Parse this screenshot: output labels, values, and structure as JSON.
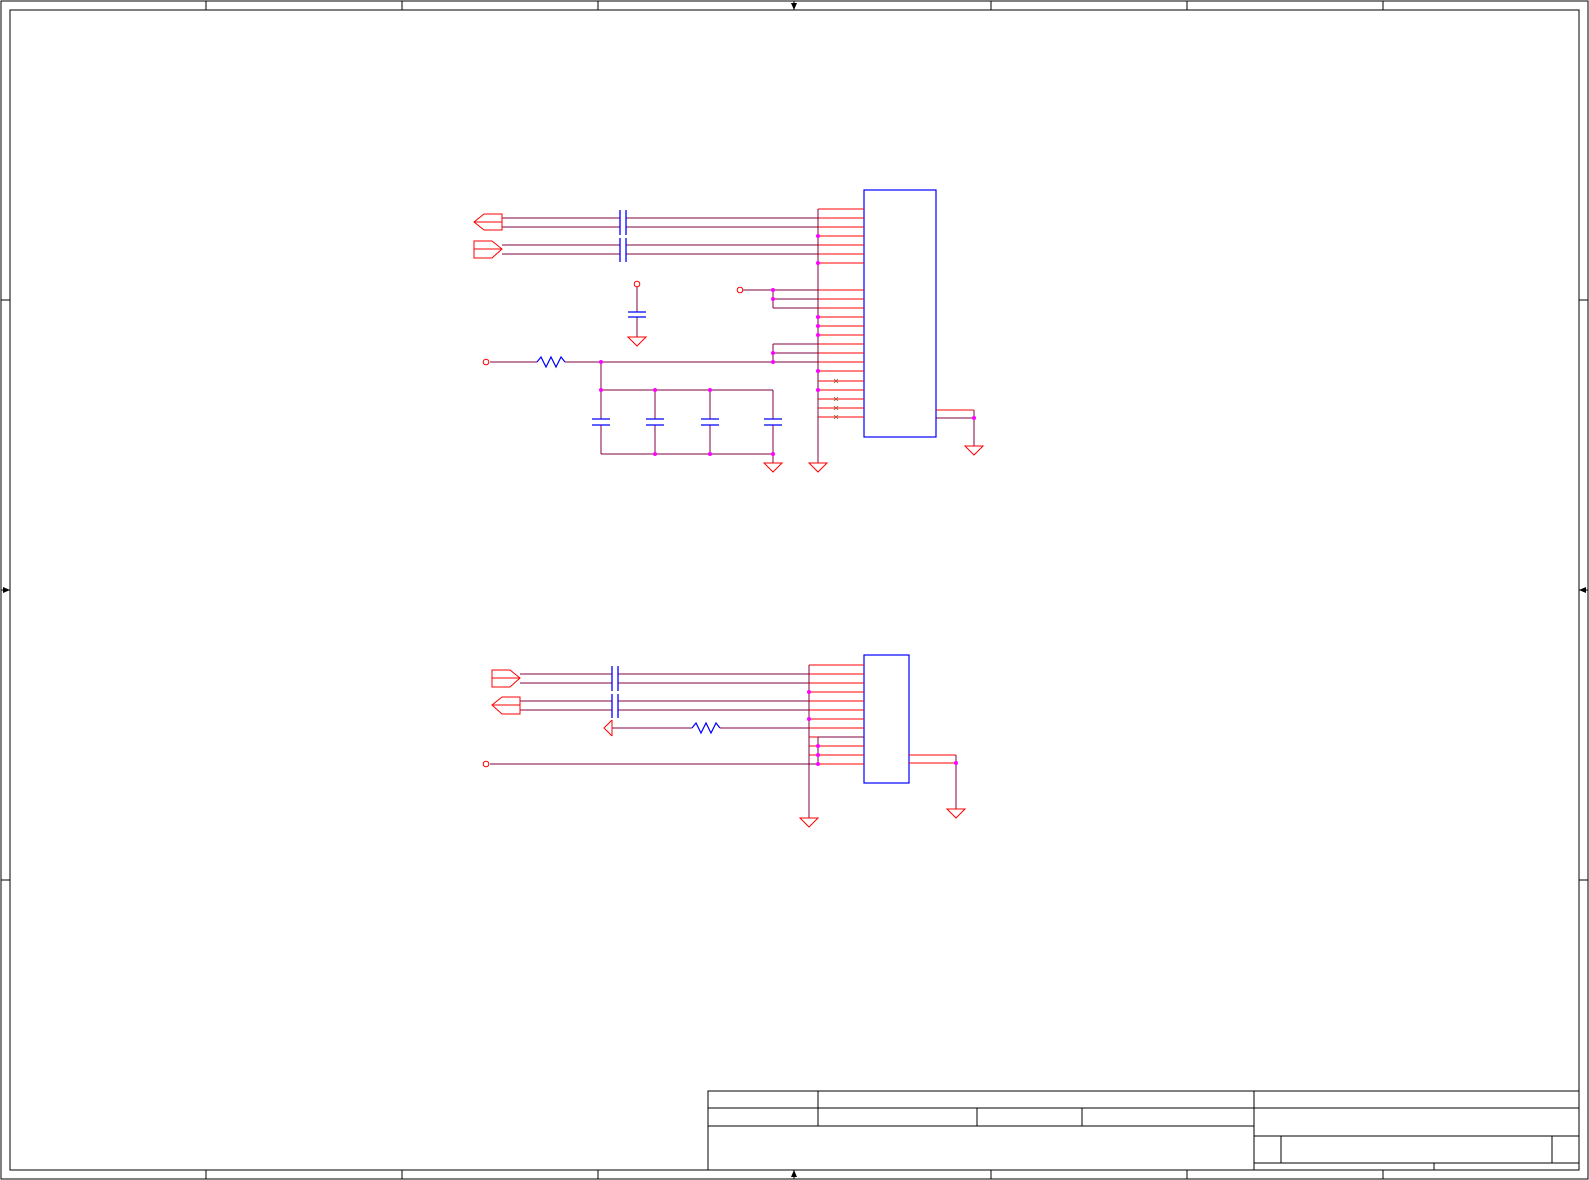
{
  "sheet": {
    "title_block_text": [],
    "colors": {
      "frame": "#000000",
      "wire": "#800040",
      "pin": "#ff0000",
      "symbol": "#ff0000",
      "component_body": "#0000ff",
      "passive": "#0000ff",
      "junction": "#ff00ff"
    }
  },
  "circuits": [
    {
      "name": "upper-connector-circuit",
      "connector_pins": 25,
      "capacitors": 7,
      "resistors": 1,
      "ground_symbols": 4
    },
    {
      "name": "lower-connector-circuit",
      "connector_pins": 13,
      "capacitors": 2,
      "resistors": 1,
      "ground_symbols": 2
    }
  ],
  "icons": [
    "arrow-marker-icon",
    "ground-icon",
    "capacitor-icon",
    "resistor-icon",
    "port-icon",
    "no-connect-icon"
  ]
}
